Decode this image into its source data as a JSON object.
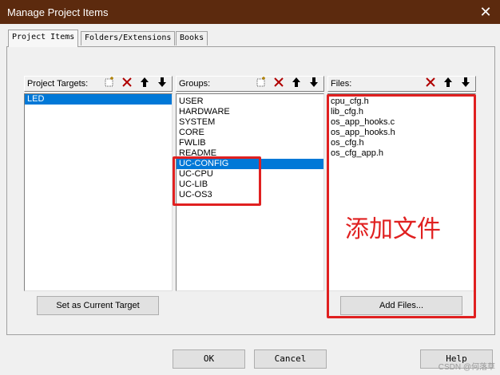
{
  "window": {
    "title": "Manage Project Items",
    "close_glyph": "✕"
  },
  "tabs": [
    {
      "label": "Project Items",
      "active": true
    },
    {
      "label": "Folders/Extensions",
      "active": false
    },
    {
      "label": "Books",
      "active": false
    }
  ],
  "targets_pane": {
    "label": "Project Targets:",
    "items": [
      "LED"
    ],
    "selected_index": 0,
    "set_current_label": "Set as Current Target"
  },
  "groups_pane": {
    "label": "Groups:",
    "items": [
      "USER",
      "HARDWARE",
      "SYSTEM",
      "CORE",
      "FWLIB",
      "README",
      "UC-CONFIG",
      "UC-CPU",
      "UC-LIB",
      "UC-OS3"
    ],
    "selected_index": 6
  },
  "files_pane": {
    "label": "Files:",
    "items": [
      "cpu_cfg.h",
      "lib_cfg.h",
      "os_app_hooks.c",
      "os_app_hooks.h",
      "os_cfg.h",
      "os_cfg_app.h"
    ],
    "add_files_label": "Add Files..."
  },
  "annotation": {
    "text": "添加文件",
    "color": "#e02020"
  },
  "footer": {
    "ok_label": "OK",
    "cancel_label": "Cancel",
    "help_label": "Help"
  },
  "watermark": "CSDN @何落草"
}
